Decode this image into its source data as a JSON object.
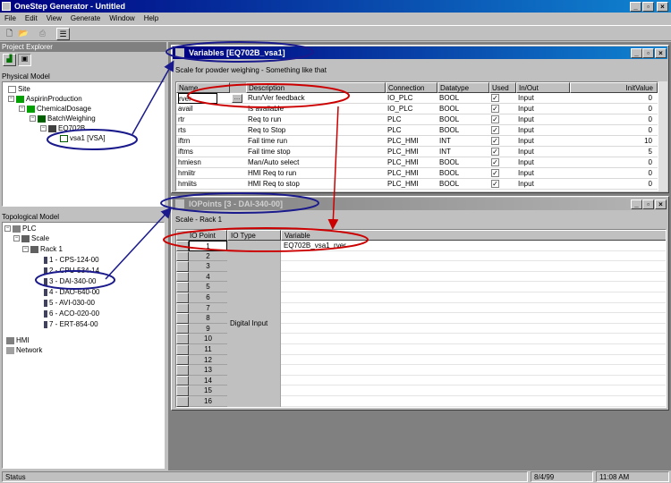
{
  "app": {
    "title": "OneStep Generator - Untitled"
  },
  "menu": [
    "File",
    "Edit",
    "View",
    "Generate",
    "Window",
    "Help"
  ],
  "explorer": {
    "title": "Project Explorer",
    "physical_label": "Physical Model",
    "physical_tree": [
      "Site",
      "AspirinProduction",
      "ChemicalDosage",
      "BatchWeighing",
      "EQ702B",
      "vsa1 [VSA]"
    ],
    "topological_label": "Topological Model",
    "topo_tree": [
      "PLC",
      "Scale",
      "Rack 1",
      "1 - CPS-124-00",
      "2 - CPU-534-14",
      "3 - DAI-340-00",
      "4 - DAO-640-00",
      "5 - AVI-030-00",
      "6 - ACO-020-00",
      "7 - ERT-854-00",
      "HMI",
      "Network"
    ]
  },
  "variables": {
    "title": "Variables [EQ702B_vsa1]",
    "caption": "Scale for powder weighing - Something like that",
    "headers": [
      "Name",
      "Description",
      "Connection",
      "Datatype",
      "Used",
      "In/Out",
      "InitValue"
    ],
    "rows": [
      [
        "rver",
        "Run/Ver feedback",
        "IO_PLC",
        "BOOL",
        "✓",
        "Input",
        "0"
      ],
      [
        "avail",
        "Is available",
        "IO_PLC",
        "BOOL",
        "✓",
        "Input",
        "0"
      ],
      [
        "rtr",
        "Req to run",
        "PLC",
        "BOOL",
        "✓",
        "Input",
        "0"
      ],
      [
        "rts",
        "Req to Stop",
        "PLC",
        "BOOL",
        "✓",
        "Input",
        "0"
      ],
      [
        "iftrn",
        "Fail time run",
        "PLC_HMI",
        "INT",
        "✓",
        "Input",
        "10"
      ],
      [
        "iftms",
        "Fail time stop",
        "PLC_HMI",
        "INT",
        "✓",
        "Input",
        "5"
      ],
      [
        "hmiesn",
        "Man/Auto select",
        "PLC_HMI",
        "BOOL",
        "✓",
        "Input",
        "0"
      ],
      [
        "hmiitr",
        "HMI Req to run",
        "PLC_HMI",
        "BOOL",
        "✓",
        "Input",
        "0"
      ],
      [
        "hmiits",
        "HMI Req to stop",
        "PLC_HMI",
        "BOOL",
        "✓",
        "Input",
        "0"
      ]
    ]
  },
  "iopoints": {
    "title": "IOPoints [3 - DAI-340-00]",
    "caption": "Scale - Rack 1",
    "headers": [
      "IO Point",
      "IO Type",
      "Variable"
    ],
    "points": [
      "1",
      "2",
      "3",
      "4",
      "5",
      "6",
      "7",
      "8",
      "9",
      "10",
      "11",
      "12",
      "13",
      "14",
      "15",
      "16"
    ],
    "io_type": "Digital Input",
    "first_variable": "EQ702B_vsa1_rver"
  },
  "status": {
    "text": "Status",
    "date": "8/4/99",
    "time": "11:08 AM"
  },
  "colors": {
    "title_active": "#000080",
    "annotation_red": "#cc0000",
    "annotation_blue": "#1a1a8c"
  }
}
